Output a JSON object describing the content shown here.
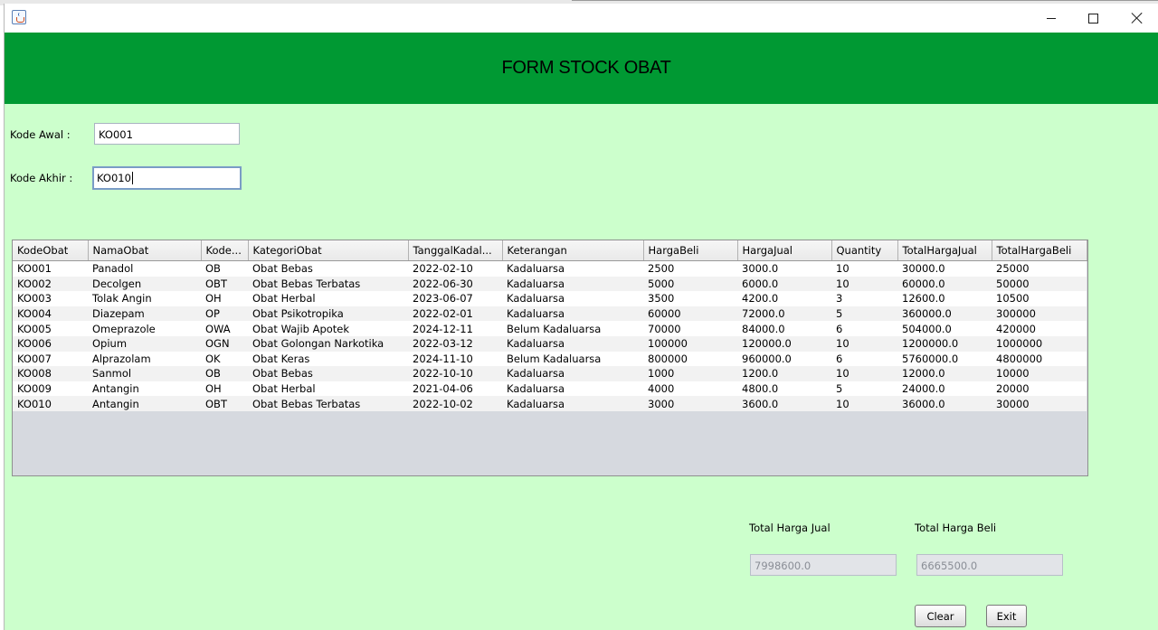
{
  "header": {
    "title": "FORM STOCK OBAT"
  },
  "form": {
    "kode_awal_label": "Kode Awal :",
    "kode_awal_value": "KO001",
    "kode_akhir_label": "Kode Akhir :",
    "kode_akhir_value": "KO010"
  },
  "table": {
    "columns": [
      "KodeObat",
      "NamaObat",
      "Kode...",
      "KategoriObat",
      "TanggalKadal...",
      "Keterangan",
      "HargaBeli",
      "HargaJual",
      "Quantity",
      "TotalHargaJual",
      "TotalHargaBeli"
    ],
    "rows": [
      [
        "KO001",
        "Panadol",
        "OB",
        "Obat Bebas",
        "2022-02-10",
        "Kadaluarsa",
        "2500",
        "3000.0",
        "10",
        "30000.0",
        "25000"
      ],
      [
        "KO002",
        "Decolgen",
        "OBT",
        "Obat Bebas Terbatas",
        "2022-06-30",
        "Kadaluarsa",
        "5000",
        "6000.0",
        "10",
        "60000.0",
        "50000"
      ],
      [
        "KO003",
        "Tolak Angin",
        "OH",
        "Obat Herbal",
        "2023-06-07",
        "Kadaluarsa",
        "3500",
        "4200.0",
        "3",
        "12600.0",
        "10500"
      ],
      [
        "KO004",
        "Diazepam",
        "OP",
        "Obat Psikotropika",
        "2022-02-01",
        "Kadaluarsa",
        "60000",
        "72000.0",
        "5",
        "360000.0",
        "300000"
      ],
      [
        "KO005",
        "Omeprazole",
        "OWA",
        "Obat Wajib Apotek",
        "2024-12-11",
        "Belum Kadaluarsa",
        "70000",
        "84000.0",
        "6",
        "504000.0",
        "420000"
      ],
      [
        "KO006",
        "Opium",
        "OGN",
        "Obat Golongan Narkotika",
        "2022-03-12",
        "Kadaluarsa",
        "100000",
        "120000.0",
        "10",
        "1200000.0",
        "1000000"
      ],
      [
        "KO007",
        "Alprazolam",
        "OK",
        "Obat Keras",
        "2024-11-10",
        "Belum Kadaluarsa",
        "800000",
        "960000.0",
        "6",
        "5760000.0",
        "4800000"
      ],
      [
        "KO008",
        "Sanmol",
        "OB",
        "Obat Bebas",
        "2022-10-10",
        "Kadaluarsa",
        "1000",
        "1200.0",
        "10",
        "12000.0",
        "10000"
      ],
      [
        "KO009",
        "Antangin",
        "OH",
        "Obat Herbal",
        "2021-04-06",
        "Kadaluarsa",
        "4000",
        "4800.0",
        "5",
        "24000.0",
        "20000"
      ],
      [
        "KO010",
        "Antangin",
        "OBT",
        "Obat Bebas Terbatas",
        "2022-10-02",
        "Kadaluarsa",
        "3000",
        "3600.0",
        "10",
        "36000.0",
        "30000"
      ]
    ]
  },
  "totals": {
    "jual_label": "Total Harga Jual",
    "jual_value": "7998600.0",
    "beli_label": "Total Harga Beli",
    "beli_value": "6665500.0"
  },
  "buttons": {
    "clear": "Clear",
    "exit": "Exit"
  },
  "icons": {
    "app": "java-cup-icon",
    "minimize": "minimize-icon",
    "maximize": "maximize-icon",
    "close": "close-icon"
  },
  "colors": {
    "header_bg": "#009933",
    "window_bg": "#ccffcc"
  }
}
